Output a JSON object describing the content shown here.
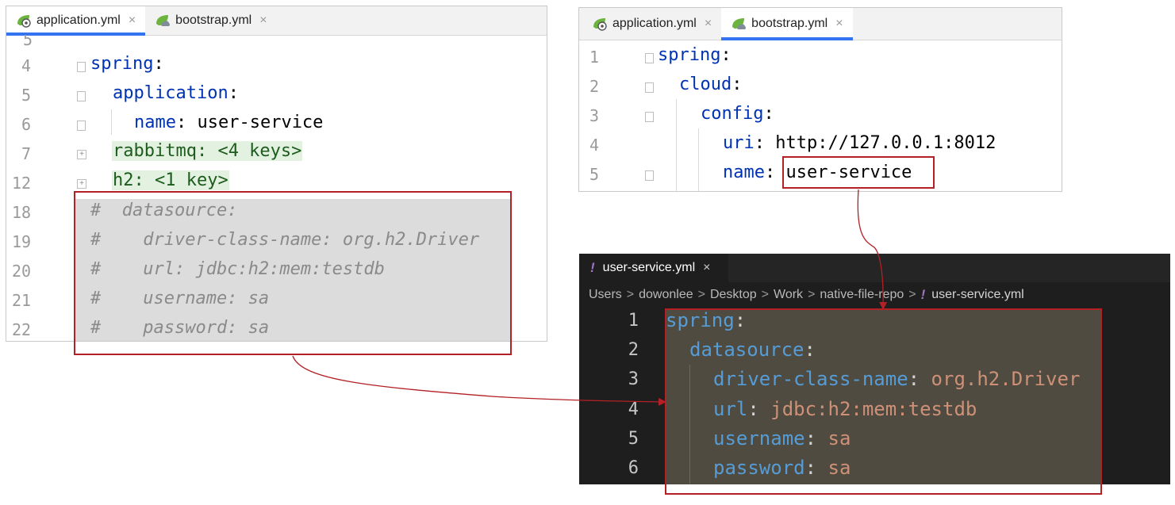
{
  "left_editor": {
    "tabs": [
      {
        "label": "application.yml",
        "close": "×",
        "active": true
      },
      {
        "label": "bootstrap.yml",
        "close": "×",
        "active": false
      }
    ],
    "line_top_partial": "5",
    "lines": [
      {
        "num": "4",
        "key": "spring",
        "punct": ":",
        "value": ""
      },
      {
        "num": "5",
        "key": "application",
        "punct": ":",
        "value": ""
      },
      {
        "num": "6",
        "key": "name",
        "punct": ": ",
        "value": "user-service"
      },
      {
        "num": "7",
        "folded": "rabbitmq: <4 keys>"
      },
      {
        "num": "12",
        "folded": "h2: <1 key>"
      },
      {
        "num": "18",
        "comment": "#  datasource:"
      },
      {
        "num": "19",
        "comment": "#    driver-class-name: org.h2.Driver"
      },
      {
        "num": "20",
        "comment": "#    url: jdbc:h2:mem:testdb"
      },
      {
        "num": "21",
        "comment": "#    username: sa"
      },
      {
        "num": "22",
        "comment": "#    password: sa"
      }
    ]
  },
  "right_top_editor": {
    "tabs": [
      {
        "label": "application.yml",
        "close": "×",
        "active": false
      },
      {
        "label": "bootstrap.yml",
        "close": "×",
        "active": true
      }
    ],
    "lines": [
      {
        "num": "1",
        "key": "spring",
        "punct": ":",
        "value": ""
      },
      {
        "num": "2",
        "key": "cloud",
        "punct": ":",
        "value": ""
      },
      {
        "num": "3",
        "key": "config",
        "punct": ":",
        "value": ""
      },
      {
        "num": "4",
        "key": "uri",
        "punct": ": ",
        "value": "http://127.0.0.1:8012"
      },
      {
        "num": "5",
        "key": "name",
        "punct": ": ",
        "value": "user-service"
      }
    ]
  },
  "vscode_editor": {
    "tab": {
      "icon": "!",
      "label": "user-service.yml",
      "close": "×"
    },
    "breadcrumb": [
      "Users",
      "dowonlee",
      "Desktop",
      "Work",
      "native-file-repo"
    ],
    "breadcrumb_file_icon": "!",
    "breadcrumb_file": "user-service.yml",
    "breadcrumb_sep": ">",
    "lines": [
      {
        "num": "1",
        "key": "spring",
        "punct": ":",
        "value": ""
      },
      {
        "num": "2",
        "key": "datasource",
        "punct": ":",
        "value": ""
      },
      {
        "num": "3",
        "key": "driver-class-name",
        "punct": ": ",
        "value": "org.h2.Driver"
      },
      {
        "num": "4",
        "key": "url",
        "punct": ": ",
        "value": "jdbc:h2:mem:testdb"
      },
      {
        "num": "5",
        "key": "username",
        "punct": ": ",
        "value": "sa"
      },
      {
        "num": "6",
        "key": "password",
        "punct": ": ",
        "value": "sa"
      }
    ]
  },
  "colors": {
    "highlight_box": "#b32025",
    "arrow": "#b32025",
    "yaml_key_light": "#0033b3",
    "yaml_key_dark": "#569cd6",
    "yaml_value_dark": "#ce9178"
  }
}
